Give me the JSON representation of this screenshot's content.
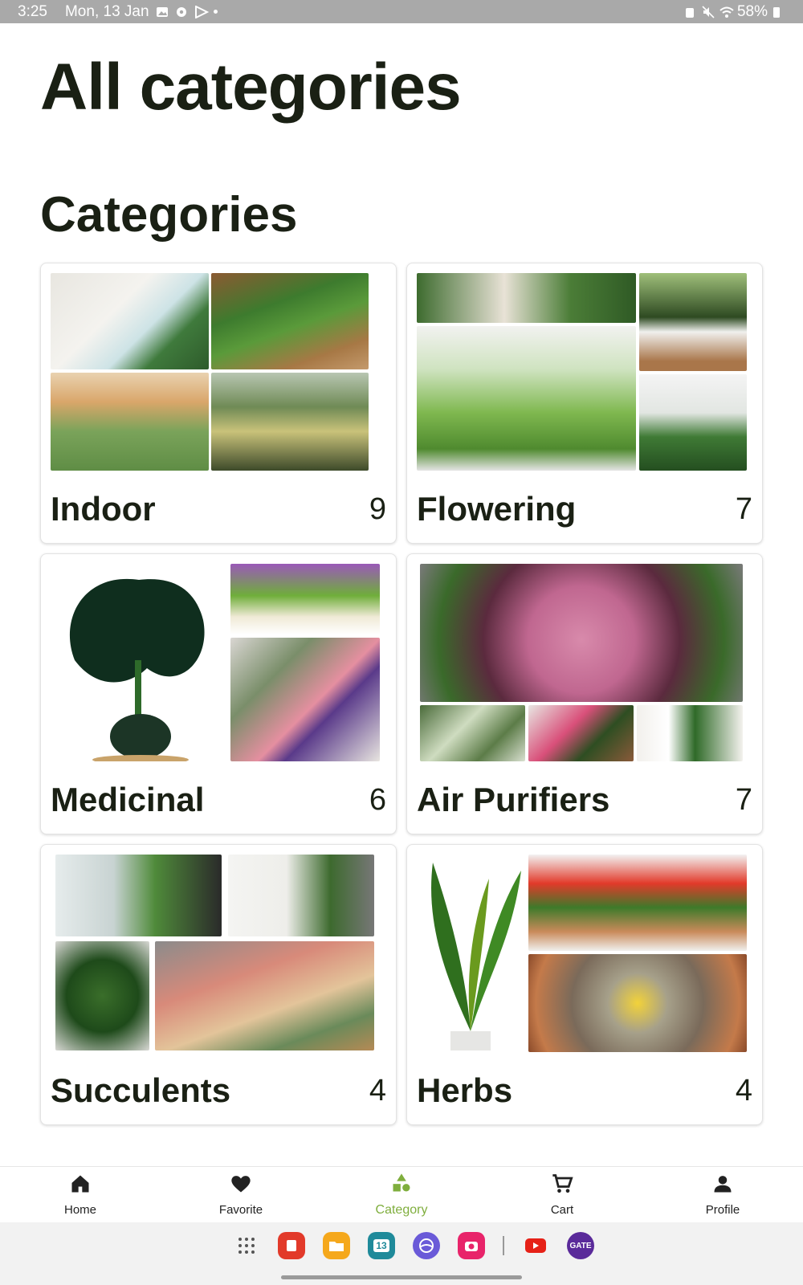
{
  "status_bar": {
    "time": "3:25",
    "date": "Mon, 13 Jan",
    "battery": "58%"
  },
  "page": {
    "title": "All categories",
    "section_title": "Categories"
  },
  "categories": [
    {
      "name": "Indoor",
      "count": "9"
    },
    {
      "name": "Flowering",
      "count": "7"
    },
    {
      "name": "Medicinal",
      "count": "6"
    },
    {
      "name": "Air Purifiers",
      "count": "7"
    },
    {
      "name": "Succulents",
      "count": "4"
    },
    {
      "name": "Herbs",
      "count": "4"
    }
  ],
  "bottom_nav": {
    "items": [
      {
        "label": "Home",
        "icon": "home-icon"
      },
      {
        "label": "Favorite",
        "icon": "heart-icon"
      },
      {
        "label": "Category",
        "icon": "category-icon"
      },
      {
        "label": "Cart",
        "icon": "cart-icon"
      },
      {
        "label": "Profile",
        "icon": "profile-icon"
      }
    ],
    "active": "Category"
  },
  "dock": {
    "calendar_day": "13",
    "gate_label": "GATE"
  },
  "colors": {
    "accent": "#7fae3d",
    "text": "#1a2014",
    "status_bar": "#a9a9a9"
  }
}
